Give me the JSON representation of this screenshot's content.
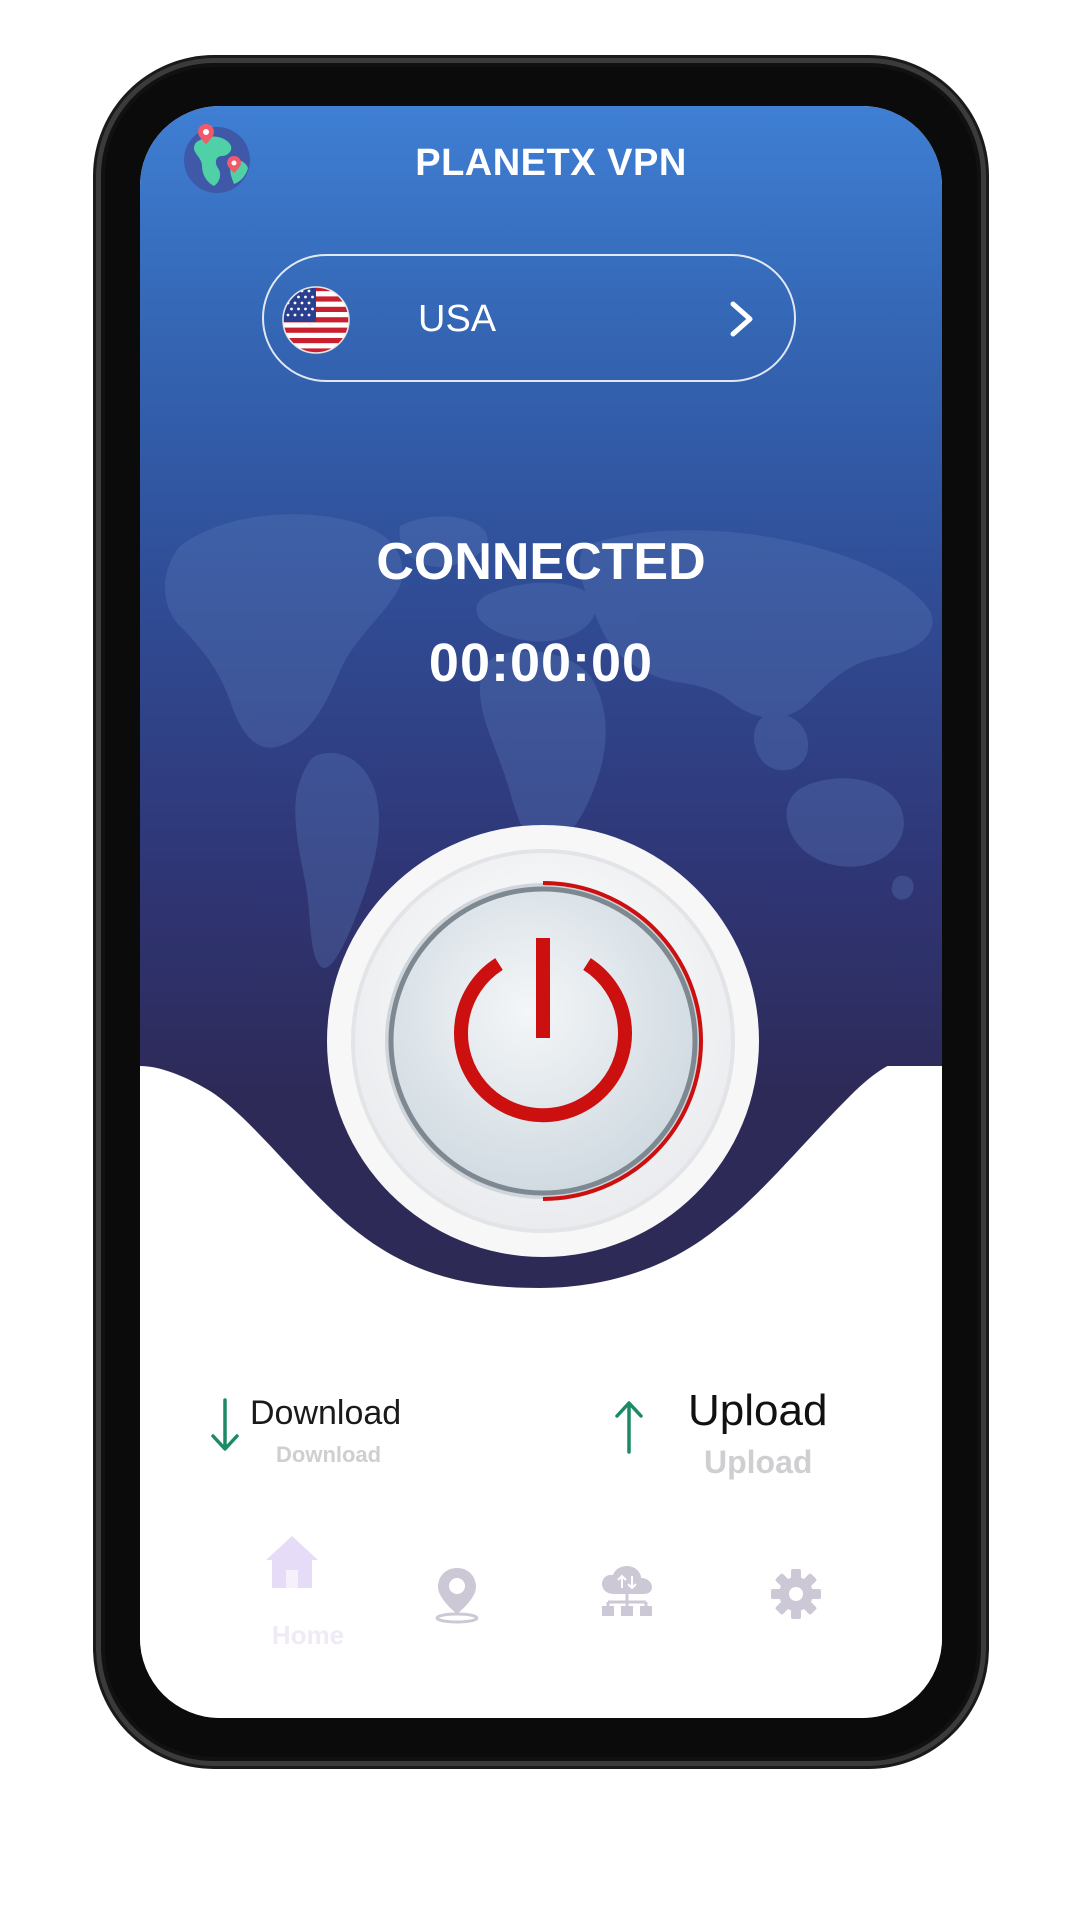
{
  "app": {
    "title": "PLANETX VPN",
    "logo_icon": "globe-pins-icon"
  },
  "server": {
    "country": "USA",
    "flag_icon": "usa-flag-icon",
    "chevron_icon": "chevron-right-icon"
  },
  "connection": {
    "status": "CONNECTED",
    "timer": "00:00:00",
    "power_icon": "power-icon"
  },
  "stats": {
    "download": {
      "label": "Download",
      "value": "Download",
      "icon": "arrow-down-icon"
    },
    "upload": {
      "label": "Upload",
      "value": "Upload",
      "icon": "arrow-up-icon"
    }
  },
  "nav": {
    "items": [
      {
        "label": "Home",
        "icon": "home-icon"
      },
      {
        "label": "",
        "icon": "location-pin-icon"
      },
      {
        "label": "",
        "icon": "cloud-network-icon"
      },
      {
        "label": "",
        "icon": "gear-icon"
      }
    ]
  },
  "colors": {
    "accent_red": "#cc1010",
    "gradient_top": "#3f7fd4",
    "gradient_bottom": "#2d2a56",
    "arrow_green": "#1d8a67",
    "nav_icon": "#cdc8d6"
  }
}
